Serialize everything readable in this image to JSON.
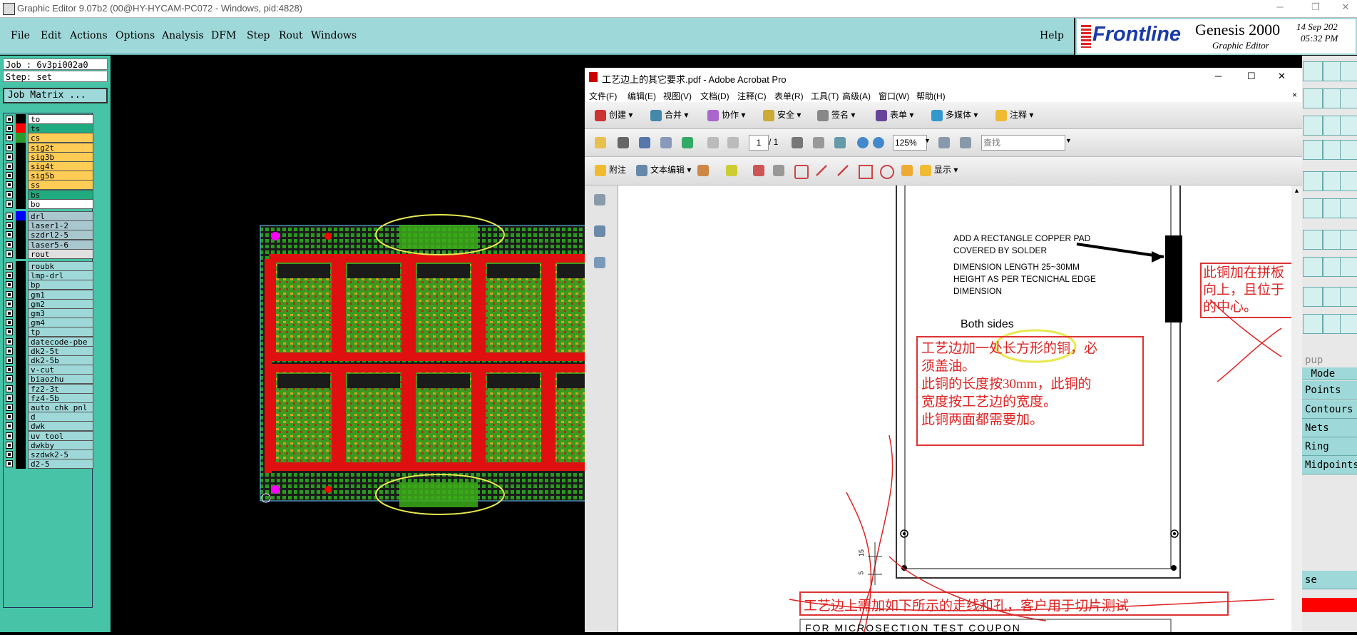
{
  "window": {
    "title": "Graphic Editor 9.07b2 (00@HY-HYCAM-PC072 - Windows, pid:4828)"
  },
  "menu": [
    "File",
    "Edit",
    "Actions",
    "Options",
    "Analysis",
    "DFM",
    "Step",
    "Rout",
    "Windows"
  ],
  "help": "Help",
  "brand": {
    "logo": "Frontline",
    "product": "Genesis 2000",
    "subtitle": "Graphic Editor",
    "date": "14 Sep 202",
    "time": "05:32 PM"
  },
  "job": {
    "job_line": "Job : 6v3pi002a0",
    "step_line": "Step: set",
    "matrix_button": "Job Matrix ..."
  },
  "layers_board": [
    {
      "name": "to",
      "color": "#ffffff",
      "swatch": "#000000"
    },
    {
      "name": "ts",
      "color": "#1faa7f",
      "swatch": "#ff0000"
    },
    {
      "name": "cs",
      "color": "#ffcc55",
      "swatch": "#2e9a2e"
    },
    {
      "name": "sig2t",
      "color": "#ffcc55",
      "swatch": "#000000"
    },
    {
      "name": "sig3b",
      "color": "#ffcc55",
      "swatch": "#000000"
    },
    {
      "name": "sig4t",
      "color": "#ffcc55",
      "swatch": "#000000"
    },
    {
      "name": "sig5b",
      "color": "#ffcc55",
      "swatch": "#000000"
    },
    {
      "name": "ss",
      "color": "#ffcc55",
      "swatch": "#000000"
    },
    {
      "name": "bs",
      "color": "#1faa7f",
      "swatch": "#000000"
    },
    {
      "name": "bo",
      "color": "#ffffff",
      "swatch": "#000000"
    }
  ],
  "layers_drill": [
    {
      "name": "drl",
      "color": "#a9c7cf",
      "swatch": "#0000ff"
    },
    {
      "name": "laser1-2",
      "color": "#a9c7cf",
      "swatch": "#000000"
    },
    {
      "name": "szdrl2-5",
      "color": "#a9c7cf",
      "swatch": "#000000"
    },
    {
      "name": "laser5-6",
      "color": "#a9c7cf",
      "swatch": "#000000"
    },
    {
      "name": "rout",
      "color": "#e0e0e0",
      "swatch": "#000000"
    }
  ],
  "layers_misc": [
    "roubk",
    "lmp-drl",
    "bp",
    "gm1",
    "gm2",
    "gm3",
    "gm4",
    "tp",
    "datecode-pbe",
    "dk2-5t",
    "dk2-5b",
    "v-cut",
    "biaozhu",
    "fz2-3t",
    "fz4-5b",
    "auto_chk_pnl",
    "d",
    "dwk",
    "uv_tool",
    "dwkby",
    "szdwk2-5",
    "d2-5"
  ],
  "acrobat": {
    "title": "工艺边上的其它要求.pdf - Adobe Acrobat Pro",
    "menu": [
      "文件(F)",
      "编辑(E)",
      "视图(V)",
      "文档(D)",
      "注释(C)",
      "表单(R)",
      "工具(T)",
      "高级(A)",
      "窗口(W)",
      "帮助(H)"
    ],
    "toolbar1": [
      "创建",
      "合并",
      "协作",
      "安全",
      "签名",
      "表单",
      "多媒体",
      "注释"
    ],
    "page_current": "1",
    "page_total": "/ 1",
    "zoom": "125%",
    "search_placeholder": "查找",
    "toolbar3": {
      "sticky": "附注",
      "text_edit": "文本编辑",
      "show": "显示"
    },
    "doc": {
      "eng1": "ADD A RECTANGLE COPPER PAD",
      "eng2": "COVERED BY SOLDER",
      "eng3": "DIMENSION LENGTH 25~30MM",
      "eng4": "HEIGHT AS PER TECNICHAL EDGE",
      "eng5": "DIMENSION",
      "both_sides": "Both sides",
      "cn1": "工艺边加一处长方形的铜，必",
      "cn2": "须盖油。",
      "cn3": "此铜的长度按30mm，此铜的",
      "cn4": "宽度按工艺边的宽度。",
      "cn5": "此铜两面都需要加。",
      "cnr1": "此铜加在拼板",
      "cnr2": "向上，且位于",
      "cnr3": "的中心。",
      "cnb": "工艺边上需加如下所示的走线和孔，客户用于切片测试",
      "bottom_text": "FOR MICROSECTION TEST COUPON",
      "ruler_15": "15",
      "ruler_5": "5"
    }
  },
  "right_panel": {
    "popup_label": "pup",
    "items": [
      "Mode",
      "Points",
      "Contours",
      "Nets",
      "Ring",
      "Midpoints"
    ],
    "close_item": "se"
  }
}
